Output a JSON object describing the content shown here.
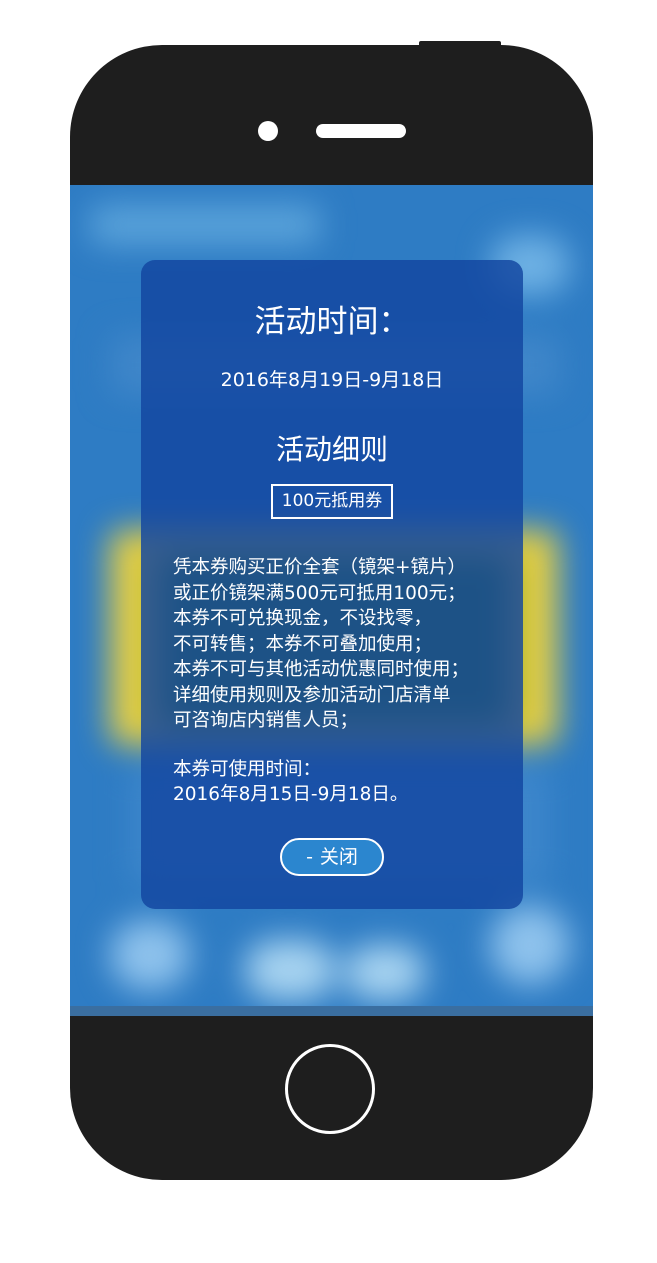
{
  "modal": {
    "heading": "活动时间：",
    "time_range": "2016年8月19日-9月18日",
    "rules_title": "活动细则",
    "coupon_badge": "100元抵用券",
    "rules_text": "凭本券购买正价全套（镜架+镜片）\n或正价镜架满500元可抵用100元；\n本券不可兑换现金，不设找零，\n不可转售；本券不可叠加使用；\n本券不可与其他活动优惠同时使用；\n详细使用规则及参加活动门店清单\n可咨询店内销售人员；",
    "validity_text": "本券可使用时间：\n2016年8月15日-9月18日。",
    "close_label": "关闭",
    "close_icon": "minus-icon"
  },
  "colors": {
    "phone_body": "#1e1e1e",
    "screen_bg": "#2e7cc4",
    "modal_bg": "#1246a0",
    "highlight_band": "#e6cf43",
    "highlight_inner": "#4f8c14",
    "close_button": "#2b86cf"
  }
}
